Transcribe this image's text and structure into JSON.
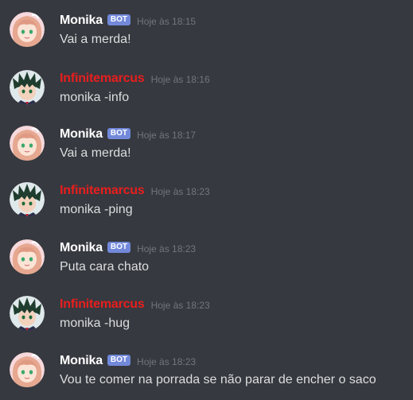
{
  "colors": {
    "background": "#36393f",
    "bot_name": "#ffffff",
    "user_name": "#e91e1e",
    "bot_tag": "#7289da",
    "timestamp": "#72767d",
    "text": "#dcddde"
  },
  "messages": [
    {
      "author": "Monika",
      "is_bot": true,
      "bot_tag": "BOT",
      "timestamp": "Hoje às 18:15",
      "content": "Vai a merda!",
      "avatar": "monika-avatar"
    },
    {
      "author": "Infinitemarcus",
      "is_bot": false,
      "bot_tag": "",
      "timestamp": "Hoje às 18:16",
      "content": "monika -info",
      "avatar": "infinitemarcus-avatar"
    },
    {
      "author": "Monika",
      "is_bot": true,
      "bot_tag": "BOT",
      "timestamp": "Hoje às 18:17",
      "content": "Vai a merda!",
      "avatar": "monika-avatar"
    },
    {
      "author": "Infinitemarcus",
      "is_bot": false,
      "bot_tag": "",
      "timestamp": "Hoje às 18:23",
      "content": "monika -ping",
      "avatar": "infinitemarcus-avatar"
    },
    {
      "author": "Monika",
      "is_bot": true,
      "bot_tag": "BOT",
      "timestamp": "Hoje às 18:23",
      "content": "Puta cara chato",
      "avatar": "monika-avatar"
    },
    {
      "author": "Infinitemarcus",
      "is_bot": false,
      "bot_tag": "",
      "timestamp": "Hoje às 18:23",
      "content": "monika -hug",
      "avatar": "infinitemarcus-avatar"
    },
    {
      "author": "Monika",
      "is_bot": true,
      "bot_tag": "BOT",
      "timestamp": "Hoje às 18:23",
      "content": "Vou te comer na porrada se não parar de encher o saco",
      "avatar": "monika-avatar"
    }
  ]
}
